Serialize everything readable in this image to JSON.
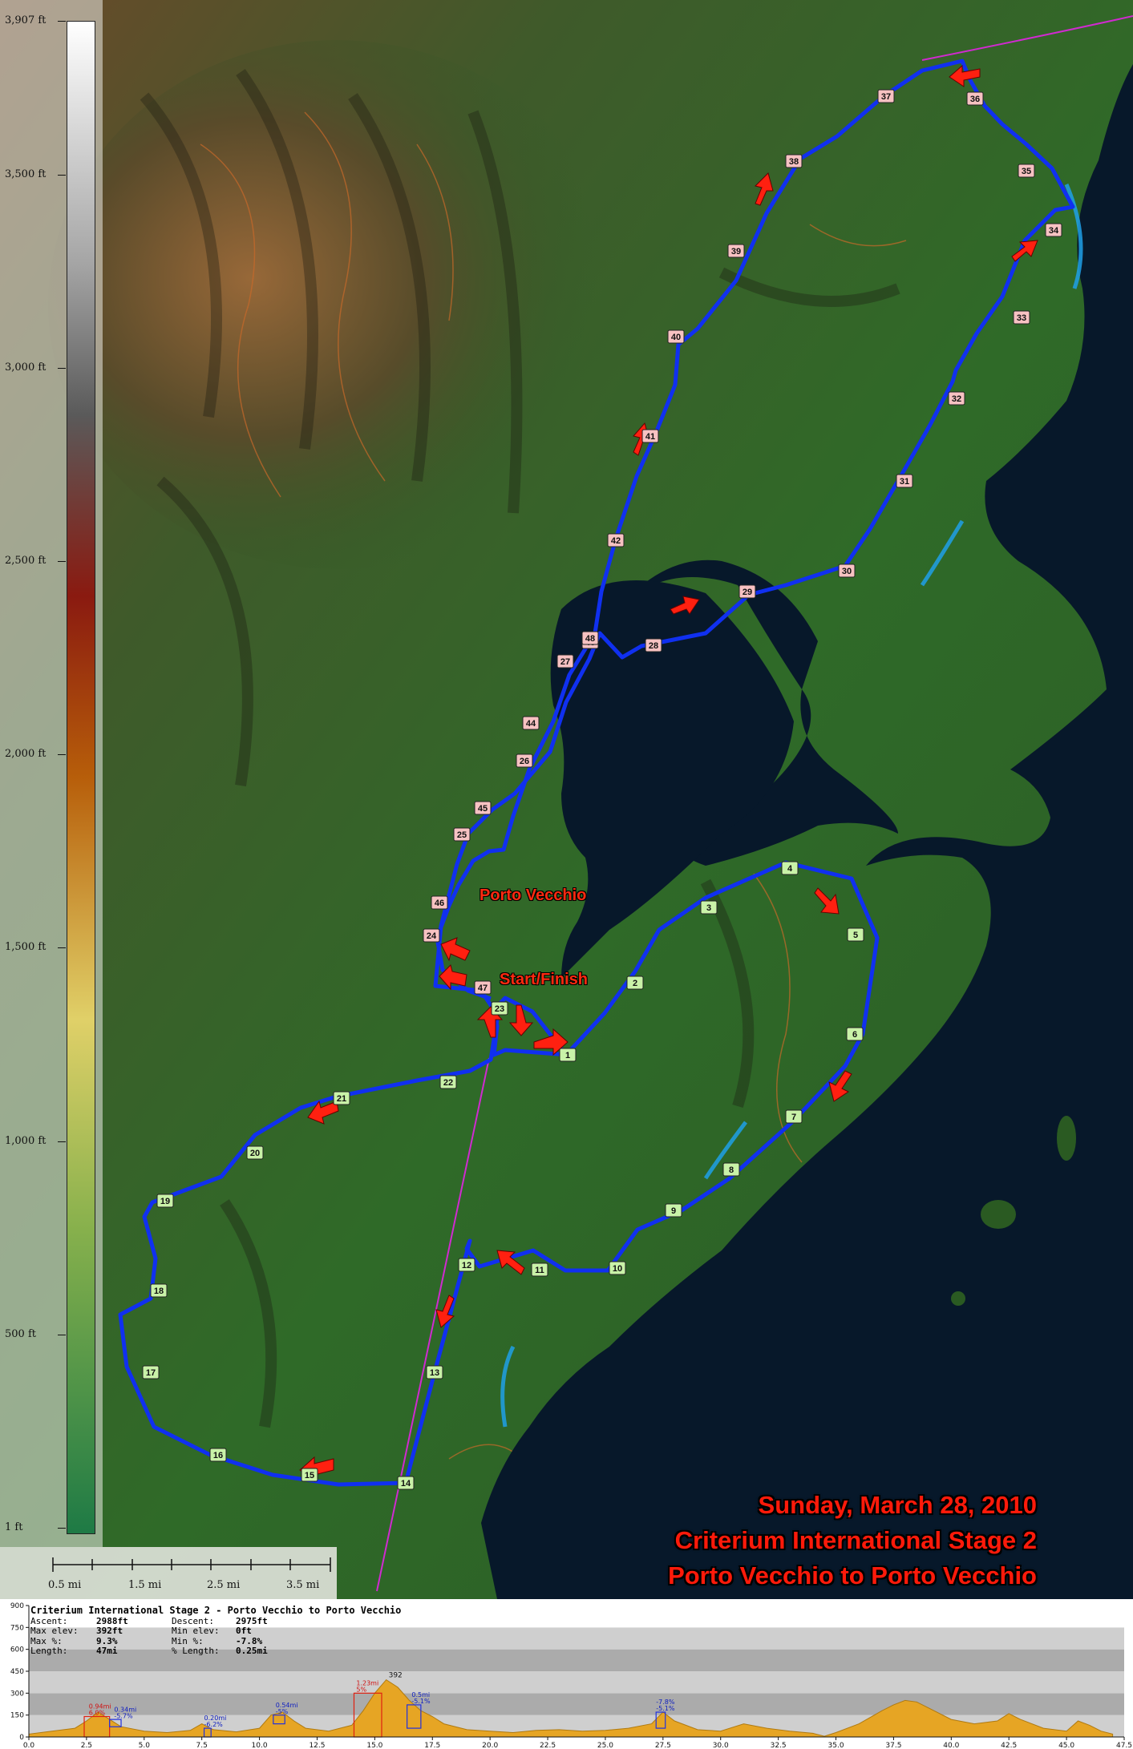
{
  "title_lines": [
    "Sunday, March 28, 2010",
    "Criterium International Stage 2",
    "Porto Vecchio to Porto Vecchio"
  ],
  "places": {
    "town": "Porto Vecchio",
    "start_finish": "Start/Finish"
  },
  "elevation_legend": {
    "ticks": [
      "3,907 ft",
      "3,500 ft",
      "3,000 ft",
      "2,500 ft",
      "2,000 ft",
      "1,500 ft",
      "1,000 ft",
      "500 ft",
      "1 ft"
    ],
    "tick_values": [
      3907,
      3500,
      3000,
      2500,
      2000,
      1500,
      1000,
      500,
      1
    ]
  },
  "scale": {
    "labels": [
      "0.5 mi",
      "1.5 mi",
      "2.5 mi",
      "3.5 mi"
    ]
  },
  "colors": {
    "route": "#1030f0",
    "arrow": "#ff2010",
    "title": "#ff1a0a",
    "marker_fill_early": "#c9f2a8",
    "marker_fill_late": "#f7c2c2",
    "profile_fill": "#e6a524"
  },
  "route": {
    "markers": [
      "1",
      "2",
      "3",
      "4",
      "5",
      "6",
      "7",
      "8",
      "9",
      "10",
      "11",
      "12",
      "13",
      "14",
      "15",
      "16",
      "17",
      "18",
      "19",
      "20",
      "21",
      "22",
      "23",
      "24",
      "25",
      "26",
      "27",
      "28",
      "29",
      "30",
      "31",
      "32",
      "33",
      "34",
      "35",
      "36",
      "37",
      "38",
      "39",
      "40",
      "41",
      "42",
      "43",
      "44",
      "45",
      "46",
      "47",
      "48"
    ]
  },
  "profile": {
    "title": "Criterium International Stage 2 - Porto Vecchio to Porto Vecchio",
    "stats": [
      {
        "k": "Ascent:",
        "v": "2988ft",
        "k2": "Descent:",
        "v2": "2975ft"
      },
      {
        "k": "Max elev:",
        "v": "392ft",
        "k2": "Min elev:",
        "v2": "0ft"
      },
      {
        "k": "Max %:",
        "v": "9.3%",
        "k2": "Min %:",
        "v2": "-7.8%"
      },
      {
        "k": "Length:",
        "v": "47mi",
        "k2": "% Length:",
        "v2": "0.25mi"
      }
    ],
    "y_ticks": [
      "900",
      "750",
      "600",
      "450",
      "300",
      "150",
      "0"
    ],
    "x_ticks": [
      "0.0",
      "2.5",
      "5.0",
      "7.5",
      "10.0",
      "12.5",
      "15.0",
      "17.5",
      "20.0",
      "22.5",
      "25.0",
      "27.5",
      "30.0",
      "32.5",
      "35.0",
      "37.5",
      "40.0",
      "42.5",
      "45.0",
      "47.5"
    ],
    "max_label": "392",
    "climb_labels": [
      {
        "d": "0.94mi",
        "g": "6.0%"
      },
      {
        "d": "0.34mi",
        "g": "-5.7%"
      },
      {
        "d": "0.20mi",
        "g": "-6.2%"
      },
      {
        "d": "0.54mi",
        "g": "-5%"
      },
      {
        "d": "1.23mi",
        "g": "5%"
      },
      {
        "d": "0.5mi",
        "g": "-5.1%"
      },
      {
        "d": "-7.8%",
        "g": "-5.1%"
      }
    ]
  },
  "chart_data": {
    "type": "area",
    "xlabel": "",
    "ylabel": "",
    "x": [
      0,
      1,
      2,
      2.5,
      3,
      3.5,
      4,
      5,
      6,
      7,
      7.5,
      8,
      9,
      10,
      10.5,
      11,
      11.5,
      12,
      13,
      14,
      14.5,
      15,
      15.5,
      16,
      16.5,
      17,
      17.5,
      18,
      19,
      20,
      21,
      22,
      23,
      24,
      25,
      26,
      27,
      27.5,
      28,
      29,
      30,
      31,
      32,
      33,
      34,
      34.5,
      35,
      36,
      37,
      37.5,
      38,
      38.5,
      39,
      40,
      41,
      42,
      42.5,
      43,
      44,
      45,
      45.5,
      46,
      46.5,
      47
    ],
    "y": [
      20,
      40,
      60,
      110,
      170,
      120,
      70,
      40,
      30,
      45,
      90,
      50,
      35,
      60,
      150,
      170,
      110,
      60,
      40,
      80,
      180,
      300,
      392,
      340,
      250,
      180,
      140,
      90,
      50,
      40,
      30,
      45,
      50,
      40,
      45,
      60,
      90,
      170,
      110,
      50,
      40,
      90,
      60,
      40,
      25,
      5,
      30,
      90,
      180,
      220,
      250,
      240,
      200,
      120,
      90,
      110,
      160,
      120,
      60,
      40,
      110,
      80,
      40,
      20
    ],
    "xlim": [
      0,
      47.5
    ],
    "ylim": [
      0,
      900
    ]
  }
}
